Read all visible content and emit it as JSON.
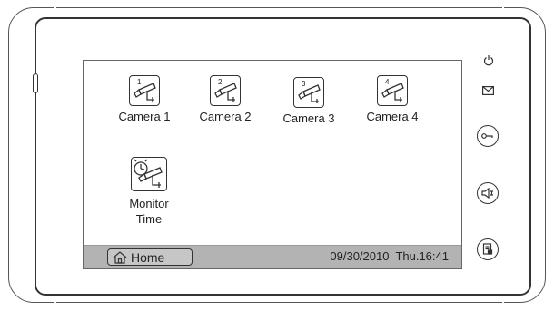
{
  "cameras": [
    {
      "label": "Camera 1",
      "number": "1"
    },
    {
      "label": "Camera 2",
      "number": "2"
    },
    {
      "label": "Camera 3",
      "number": "3"
    },
    {
      "label": "Camera 4",
      "number": "4"
    }
  ],
  "monitor_time": {
    "line1": "Monitor",
    "line2": "Time"
  },
  "status_bar": {
    "home_label": "Home",
    "datetime": "09/30/2010  Thu.16:41"
  },
  "side_controls": {
    "icons": [
      "power-icon",
      "mail-icon",
      "unlock-key-icon",
      "speaker-icon",
      "memo-icon"
    ]
  }
}
